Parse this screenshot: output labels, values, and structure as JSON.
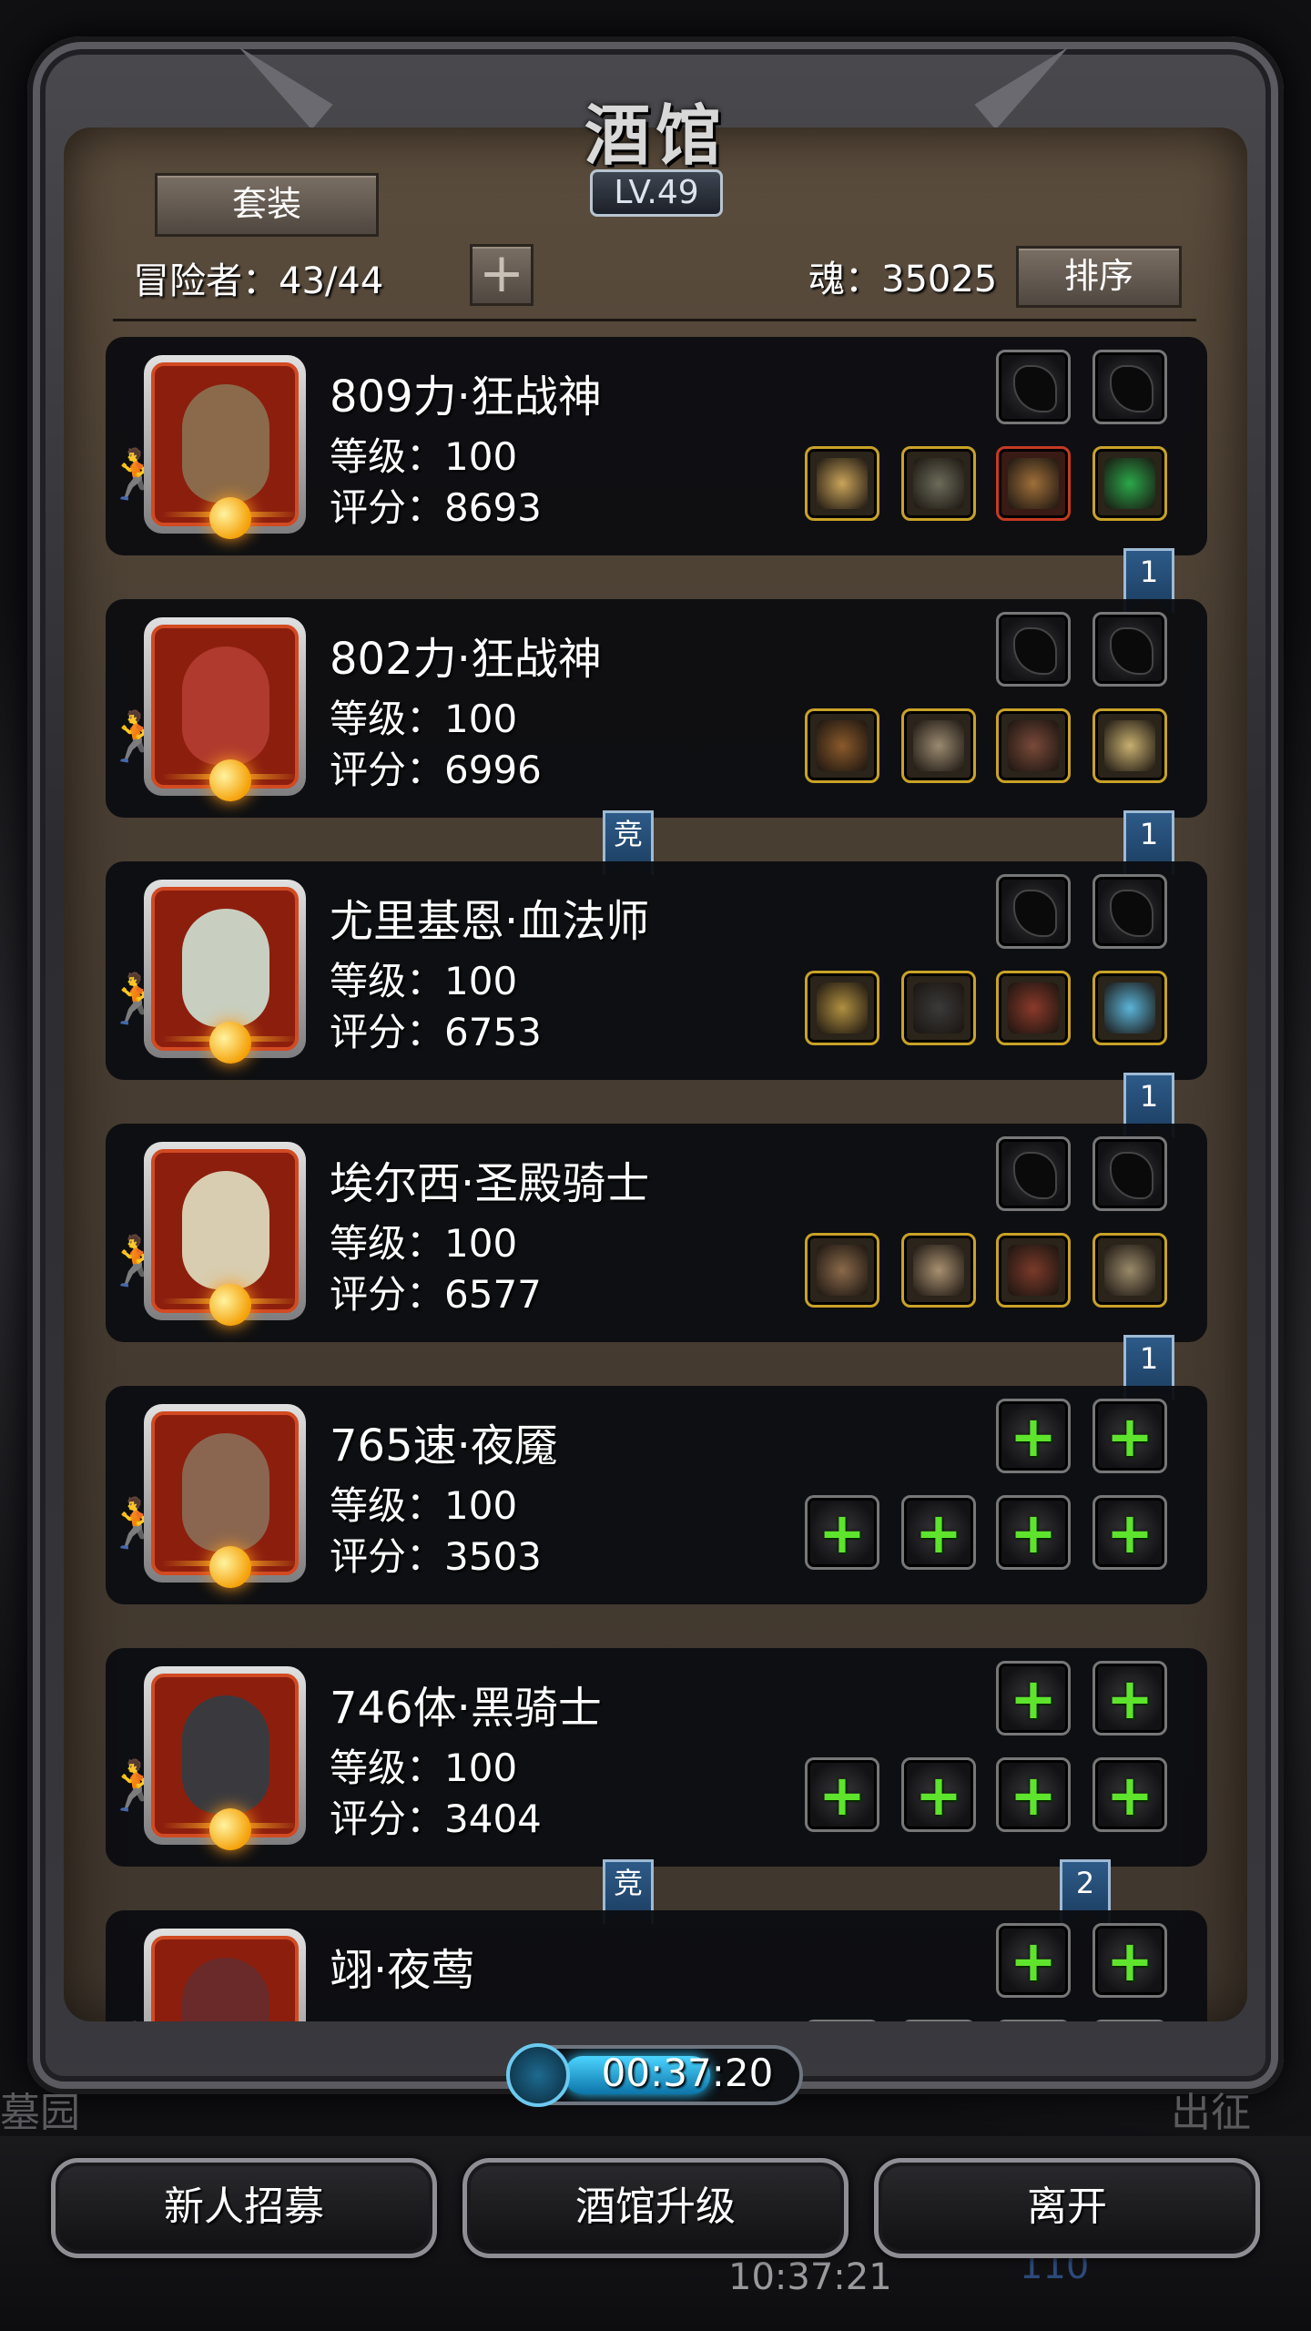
{
  "title": "酒馆",
  "level": "LV.49",
  "buttons": {
    "suit": "套装",
    "sort": "排序",
    "add": "+"
  },
  "adventurers": "冒险者：43/44",
  "soul": "魂：35025",
  "heroes": [
    {
      "name": "809力·狂战神",
      "level": "等级：100",
      "score": "评分：8693",
      "ribbon": "1",
      "ribbon2": "",
      "gear_empty": false,
      "face_color": "#8a6a4a"
    },
    {
      "name": "802力·狂战神",
      "level": "等级：100",
      "score": "评分：6996",
      "ribbon": "1",
      "ribbon2": "竞",
      "gear_empty": false,
      "face_color": "#b03a2e"
    },
    {
      "name": "尤里基恩·血法师",
      "level": "等级：100",
      "score": "评分：6753",
      "ribbon": "1",
      "ribbon2": "",
      "gear_empty": false,
      "face_color": "#c8cfc0"
    },
    {
      "name": "埃尔西·圣殿骑士",
      "level": "等级：100",
      "score": "评分：6577",
      "ribbon": "1",
      "ribbon2": "",
      "gear_empty": false,
      "face_color": "#d8cdb0"
    },
    {
      "name": "765速·夜魇",
      "level": "等级：100",
      "score": "评分：3503",
      "ribbon": "",
      "ribbon2": "",
      "gear_empty": true,
      "face_color": "#8a6650"
    },
    {
      "name": "746体·黑骑士",
      "level": "等级：100",
      "score": "评分：3404",
      "ribbon": "2",
      "ribbon2": "竞",
      "gear_empty": true,
      "face_color": "#3a3a3e"
    },
    {
      "name": "翊·夜莺",
      "level": "",
      "score": "",
      "ribbon": "",
      "ribbon2": "",
      "gear_empty": true,
      "face_color": "#6a2a2a"
    }
  ],
  "timer": "00:37:20",
  "bottom": {
    "recruit": "新人招募",
    "upgrade": "酒馆升级",
    "leave": "离开"
  },
  "background_text": {
    "left": "墓园",
    "right": "出征",
    "clock": "10:37:21",
    "count": "110"
  },
  "colors": {
    "accent_green": "#5ee42c",
    "ribbon_blue": "#2d5a88",
    "gold_border": "#c9a227"
  }
}
